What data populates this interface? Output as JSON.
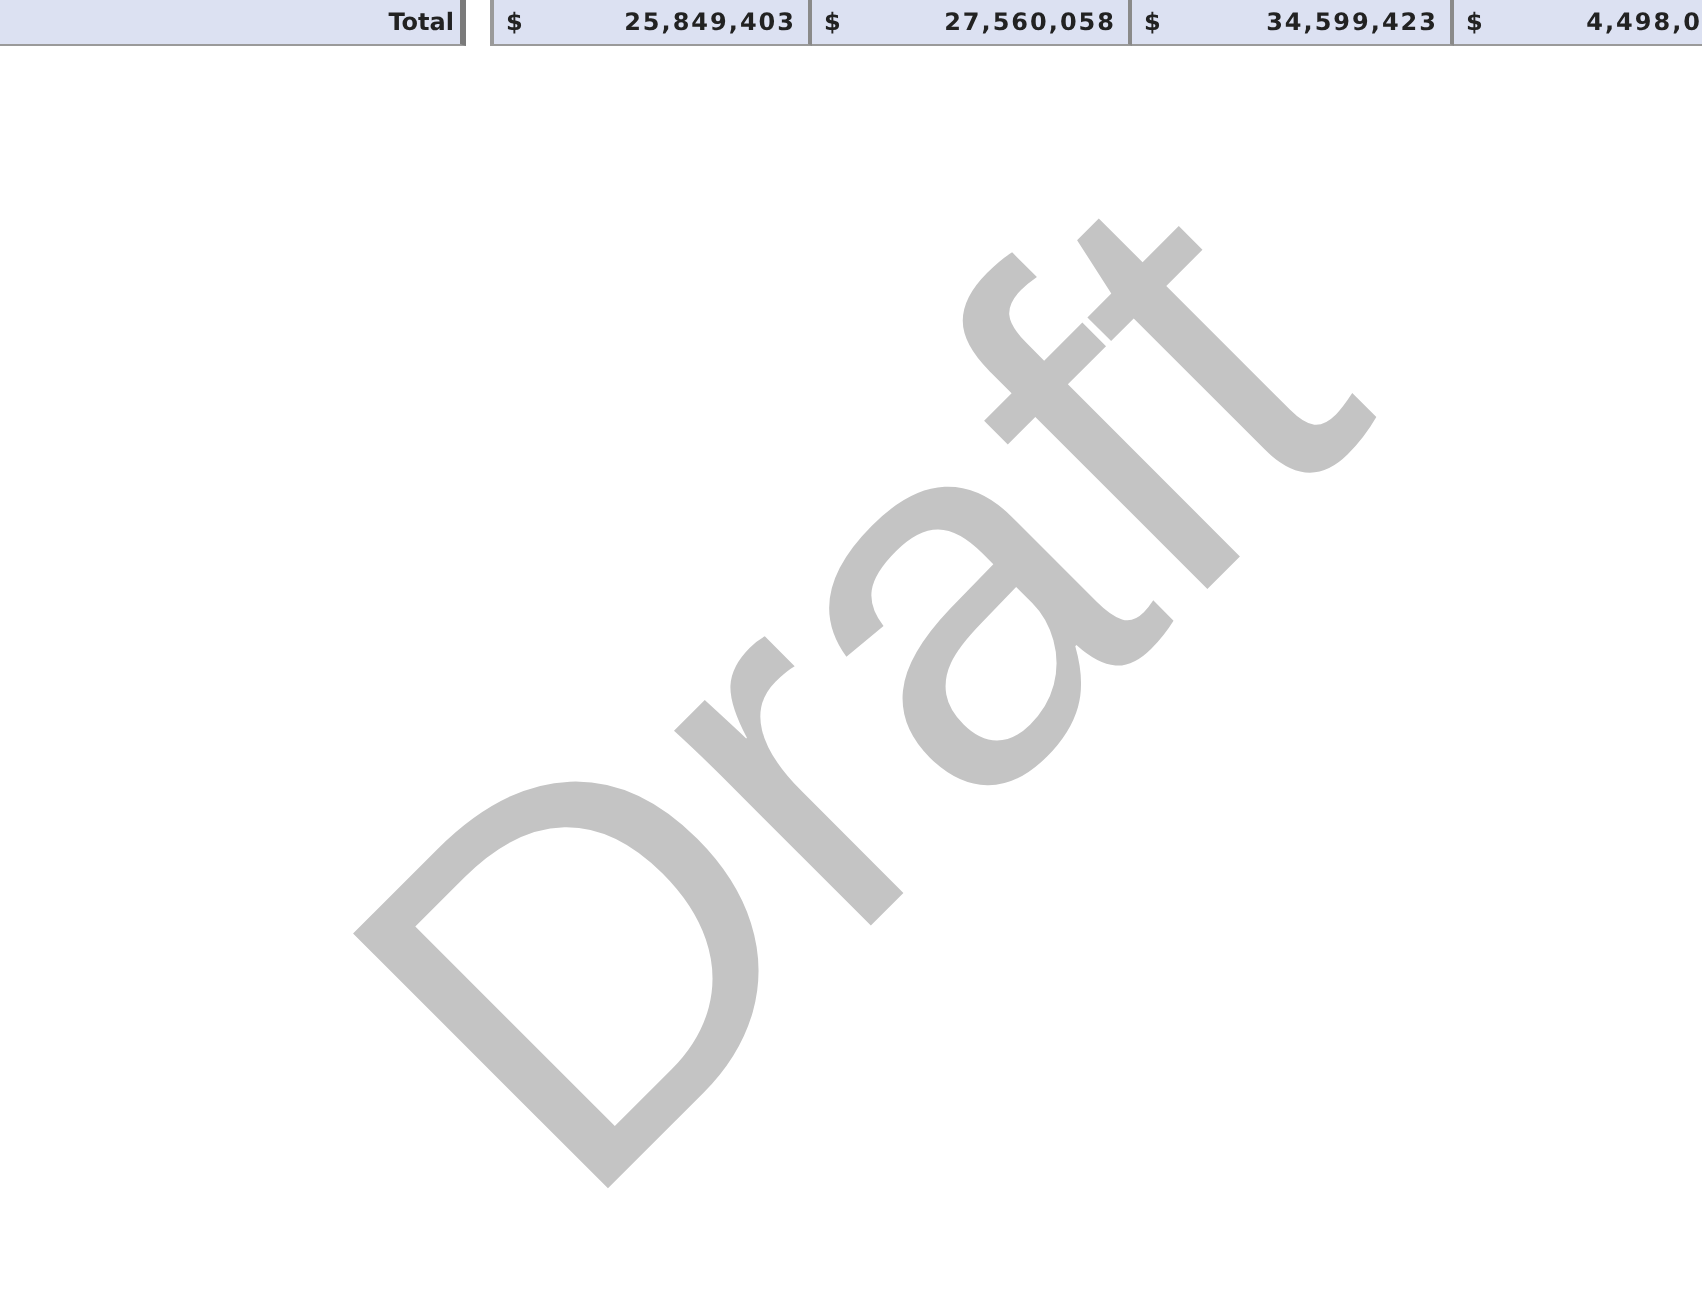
{
  "total_row": {
    "label": "Total",
    "cells": [
      {
        "currency": "$",
        "amount": "25,849,403"
      },
      {
        "currency": "$",
        "amount": "27,560,058"
      },
      {
        "currency": "$",
        "amount": "34,599,423"
      },
      {
        "currency": "$",
        "amount": "4,498,0"
      }
    ]
  },
  "watermark": "Draft"
}
